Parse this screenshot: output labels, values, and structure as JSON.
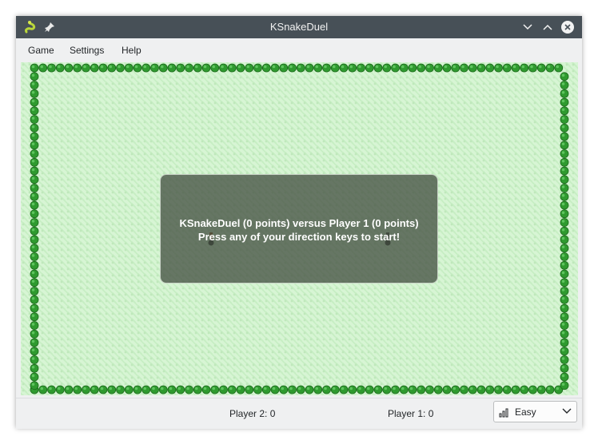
{
  "window": {
    "title": "KSnakeDuel"
  },
  "menubar": {
    "items": [
      "Game",
      "Settings",
      "Help"
    ]
  },
  "overlay": {
    "line1": "KSnakeDuel (0 points) versus Player 1 (0 points)",
    "line2": "Press any of your direction keys to start!"
  },
  "status": {
    "player2": "Player 2: 0",
    "player1": "Player 1: 0",
    "difficulty": "Easy"
  },
  "icons": {
    "app": "snake-icon",
    "pin": "pin-icon",
    "minimize": "chevron-down-icon",
    "maximize": "chevron-up-icon",
    "close": "close-icon",
    "difficulty": "signal-bars-icon",
    "dropdown": "chevron-down-icon"
  },
  "colors": {
    "titlebar": "#475057",
    "board_background": "#d7f5d4",
    "border_bush": "#2f9a2f",
    "overlay": "#465244"
  }
}
